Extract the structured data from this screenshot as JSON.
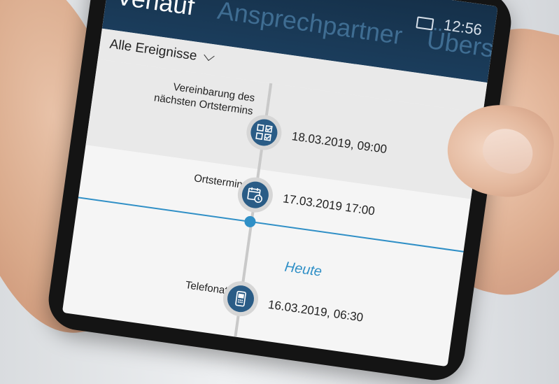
{
  "status": {
    "time": "12:56"
  },
  "pivot": {
    "tabs": [
      "Verlauf",
      "Ansprechpartner",
      "Übers"
    ]
  },
  "filter": {
    "label": "Alle Ereignisse"
  },
  "events": [
    {
      "label_line1": "Vereinbarung des",
      "label_line2": "nächsten Ortstermins",
      "date": "18.03.2019, 09:00",
      "icon": "checklist-icon"
    },
    {
      "label": "Ortstermin",
      "date": "17.03.2019 17:00",
      "icon": "calendar-clock-icon"
    },
    {
      "label": "Telefonat",
      "date": "16.03.2019, 06:30",
      "icon": "phone-icon"
    }
  ],
  "today_label": "Heute",
  "colors": {
    "appbar": "#153049",
    "accent": "#2f8fc6",
    "node": "#2a5c86"
  }
}
